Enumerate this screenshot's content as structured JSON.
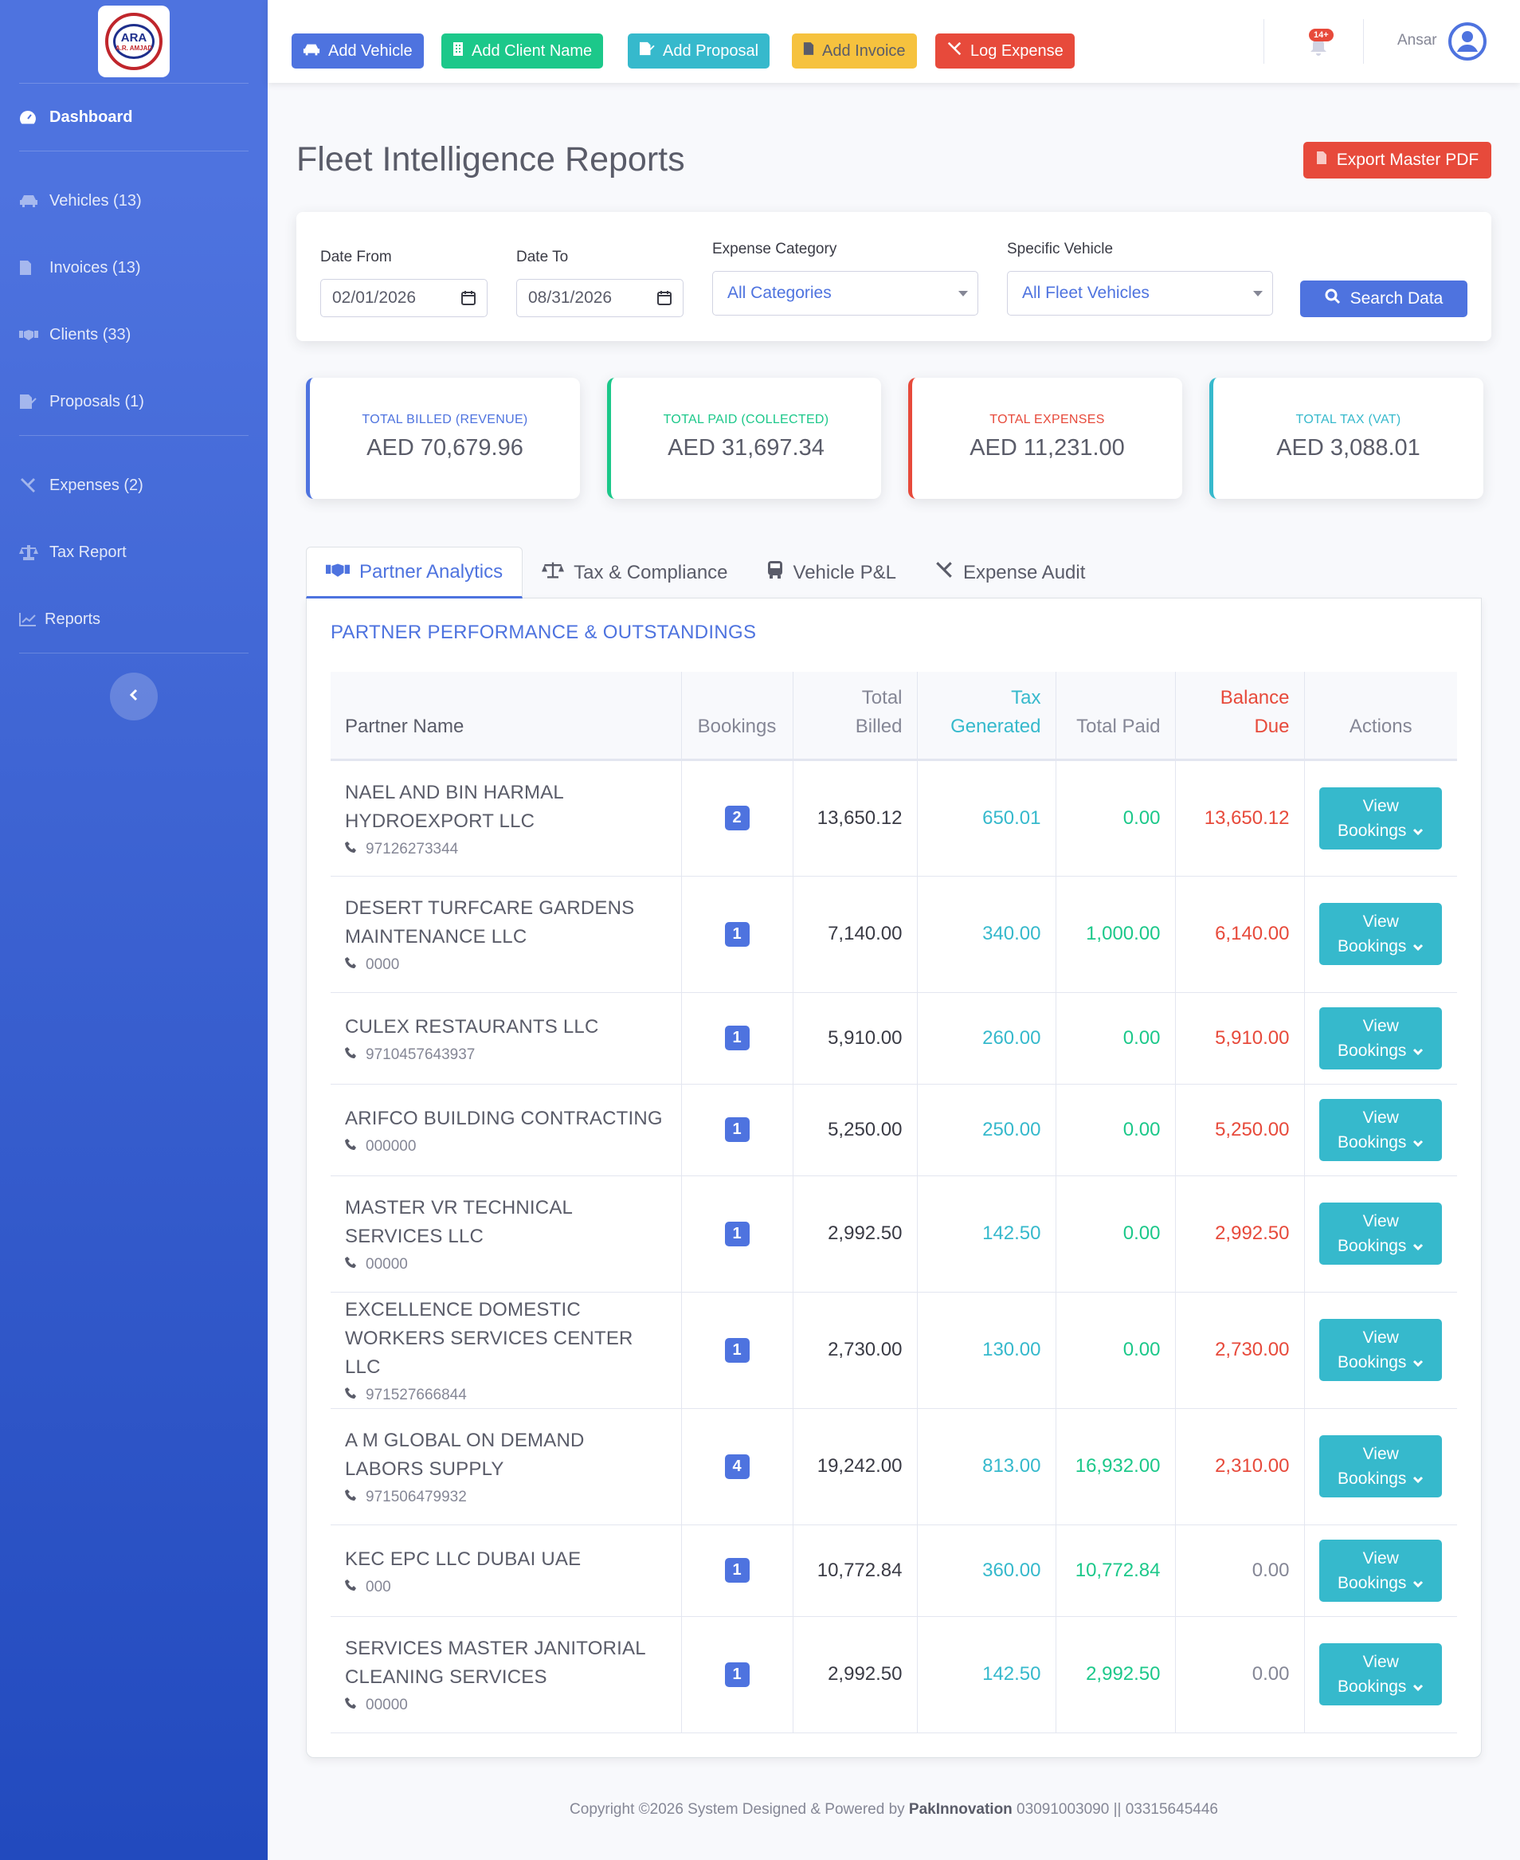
{
  "brand": {
    "logo_main": "ARA",
    "logo_sub": "A.R. AMJAD"
  },
  "sidebar": {
    "items": [
      {
        "label": "Dashboard",
        "icon": "tachometer-icon"
      },
      {
        "label": "Vehicles (13)",
        "icon": "car-icon"
      },
      {
        "label": "Invoices (13)",
        "icon": "invoice-icon"
      },
      {
        "label": "Clients (33)",
        "icon": "handshake-icon"
      },
      {
        "label": "Proposals (1)",
        "icon": "file-signature-icon"
      },
      {
        "label": "Expenses (2)",
        "icon": "tools-icon"
      },
      {
        "label": "Tax Report",
        "icon": "balance-scale-icon"
      },
      {
        "label": "Reports",
        "icon": "chart-line-icon"
      }
    ]
  },
  "topbar": {
    "buttons": [
      {
        "label": "Add Vehicle",
        "color": "#4e73df"
      },
      {
        "label": "Add Client Name",
        "color": "#1cc88a"
      },
      {
        "label": "Add Proposal",
        "color": "#36b9cc"
      },
      {
        "label": "Add Invoice",
        "color": "#f6c23e"
      },
      {
        "label": "Log Expense",
        "color": "#e74a3b"
      }
    ],
    "alerts_badge": "14+",
    "user_name": "Ansar"
  },
  "page": {
    "title": "Fleet Intelligence Reports",
    "export_label": "Export Master PDF"
  },
  "filters": {
    "date_from_label": "Date From",
    "date_from_value": "02/01/2026",
    "date_to_label": "Date To",
    "date_to_value": "08/31/2026",
    "category_label": "Expense Category",
    "category_value": "All Categories",
    "vehicle_label": "Specific Vehicle",
    "vehicle_value": "All Fleet Vehicles",
    "search_label": "Search Data"
  },
  "stats": [
    {
      "label": "TOTAL BILLED (REVENUE)",
      "value": "AED 70,679.96",
      "color": "#4e73df"
    },
    {
      "label": "TOTAL PAID (COLLECTED)",
      "value": "AED 31,697.34",
      "color": "#1cc88a"
    },
    {
      "label": "TOTAL EXPENSES",
      "value": "AED 11,231.00",
      "color": "#e74a3b"
    },
    {
      "label": "TOTAL TAX (VAT)",
      "value": "AED 3,088.01",
      "color": "#36b9cc"
    }
  ],
  "tabs": [
    {
      "label": "Partner Analytics",
      "icon": "handshake-icon",
      "active": true
    },
    {
      "label": "Tax & Compliance",
      "icon": "balance-scale-icon",
      "active": false
    },
    {
      "label": "Vehicle P&L",
      "icon": "bus-icon",
      "active": false
    },
    {
      "label": "Expense Audit",
      "icon": "tools-icon",
      "active": false
    }
  ],
  "section_title": "PARTNER PERFORMANCE & OUTSTANDINGS",
  "table": {
    "headers": {
      "partner": "Partner Name",
      "bookings": "Bookings",
      "billed_1": "Total",
      "billed_2": "Billed",
      "tax_1": "Tax",
      "tax_2": "Generated",
      "paid": "Total Paid",
      "balance_1": "Balance",
      "balance_2": "Due",
      "actions": "Actions"
    },
    "action_line1": "View",
    "action_line2": "Bookings",
    "rows": [
      {
        "name": "NAEL AND BIN HARMAL HYDROEXPORT LLC",
        "phone": "97126273344",
        "bookings": "2",
        "billed": "13,650.12",
        "tax": "650.01",
        "paid": "0.00",
        "balance": "13,650.12",
        "balance_due": true
      },
      {
        "name": "DESERT TURFCARE GARDENS MAINTENANCE LLC",
        "phone": "0000",
        "bookings": "1",
        "billed": "7,140.00",
        "tax": "340.00",
        "paid": "1,000.00",
        "balance": "6,140.00",
        "balance_due": true
      },
      {
        "name": "CULEX RESTAURANTS LLC",
        "phone": "9710457643937",
        "bookings": "1",
        "billed": "5,910.00",
        "tax": "260.00",
        "paid": "0.00",
        "balance": "5,910.00",
        "balance_due": true
      },
      {
        "name": "ARIFCO BUILDING CONTRACTING",
        "phone": "000000",
        "bookings": "1",
        "billed": "5,250.00",
        "tax": "250.00",
        "paid": "0.00",
        "balance": "5,250.00",
        "balance_due": true
      },
      {
        "name": "MASTER VR TECHNICAL SERVICES LLC",
        "phone": "00000",
        "bookings": "1",
        "billed": "2,992.50",
        "tax": "142.50",
        "paid": "0.00",
        "balance": "2,992.50",
        "balance_due": true
      },
      {
        "name": "EXCELLENCE DOMESTIC WORKERS SERVICES CENTER LLC",
        "phone": "971527666844",
        "bookings": "1",
        "billed": "2,730.00",
        "tax": "130.00",
        "paid": "0.00",
        "balance": "2,730.00",
        "balance_due": true
      },
      {
        "name": "A M GLOBAL ON DEMAND LABORS SUPPLY",
        "phone": "971506479932",
        "bookings": "4",
        "billed": "19,242.00",
        "tax": "813.00",
        "paid": "16,932.00",
        "balance": "2,310.00",
        "balance_due": true
      },
      {
        "name": "KEC EPC LLC DUBAI UAE",
        "phone": "000",
        "bookings": "1",
        "billed": "10,772.84",
        "tax": "360.00",
        "paid": "10,772.84",
        "balance": "0.00",
        "balance_due": false
      },
      {
        "name": "SERVICES MASTER JANITORIAL CLEANING SERVICES",
        "phone": "00000",
        "bookings": "1",
        "billed": "2,992.50",
        "tax": "142.50",
        "paid": "2,992.50",
        "balance": "0.00",
        "balance_due": false
      }
    ]
  },
  "colors": {
    "primary": "#4e73df",
    "success": "#1cc88a",
    "info": "#36b9cc",
    "warning": "#f6c23e",
    "danger": "#e74a3b"
  },
  "footer": {
    "prefix": "Copyright ©2026 System Designed & Powered by ",
    "company": "PakInnovation",
    "contacts": " 03091003090 || 03315645446"
  }
}
